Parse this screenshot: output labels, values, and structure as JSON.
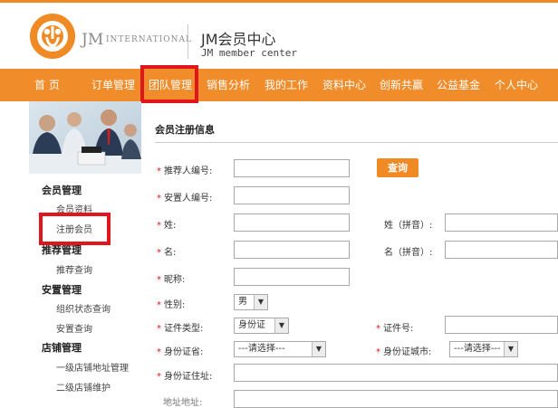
{
  "header": {
    "logo_text": "JM",
    "logo_sub": "INTERNATIONAL",
    "title": "JM会员中心",
    "subtitle": "JM member center"
  },
  "nav": {
    "items": [
      {
        "label": "首  页"
      },
      {
        "label": "订单管理"
      },
      {
        "label": "团队管理"
      },
      {
        "label": "销售分析"
      },
      {
        "label": "我的工作"
      },
      {
        "label": "资料中心"
      },
      {
        "label": "创新共赢"
      },
      {
        "label": "公益基金"
      },
      {
        "label": "个人中心"
      }
    ],
    "active_index": 2
  },
  "sidebar": {
    "groups": [
      {
        "title": "会员管理",
        "items": [
          "会员资料",
          "注册会员"
        ]
      },
      {
        "title": "推荐管理",
        "items": [
          "推荐查询"
        ]
      },
      {
        "title": "安置管理",
        "items": [
          "组织状态查询",
          "安置查询"
        ]
      },
      {
        "title": "店铺管理",
        "items": [
          "一级店铺地址管理",
          "二级店铺维护"
        ]
      }
    ],
    "active_item": "注册会员"
  },
  "form": {
    "section_title": "会员注册信息",
    "required_mark": "*",
    "labels": {
      "referrer_no": "推荐人编号:",
      "placer_no": "安置人编号:",
      "surname": "姓:",
      "given_name": "名:",
      "nickname": "昵称:",
      "gender": "性别:",
      "id_type": "证件类型:",
      "id_province": "身份证省:",
      "id_address": "身份证住址:",
      "surname_pinyin": "姓（拼音）:",
      "given_name_pinyin": "名（拼音）:",
      "id_number": "证件号:",
      "id_city": "身份证城市:",
      "partial_label": "地址地址:"
    },
    "query_button": "查询",
    "gender_value": "男",
    "id_type_value": "身份证",
    "province_value": "---请选择---",
    "city_value": "---请选择---"
  },
  "colors": {
    "brand_orange": "#f18c2a",
    "highlight_red": "#e1151b"
  }
}
